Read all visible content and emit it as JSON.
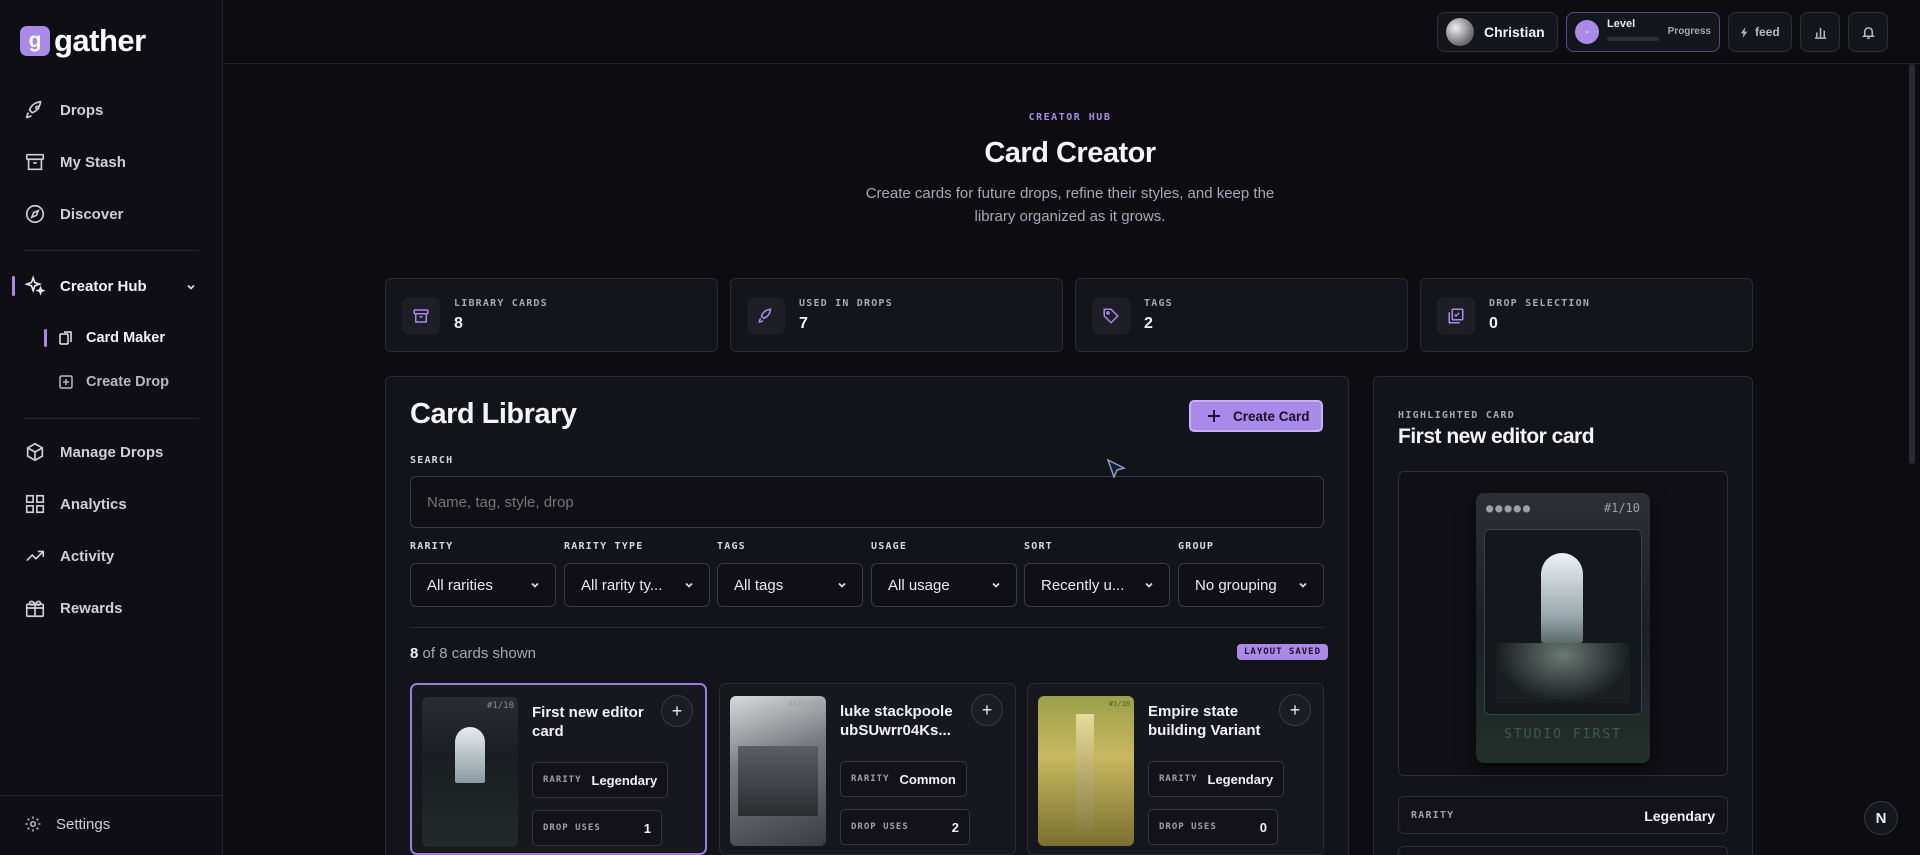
{
  "brand": {
    "logo_letter": "g",
    "name": "gather"
  },
  "sidebar": {
    "items": [
      {
        "label": "Drops"
      },
      {
        "label": "My Stash"
      },
      {
        "label": "Discover"
      },
      {
        "label": "Creator Hub"
      },
      {
        "label": "Card Maker"
      },
      {
        "label": "Create Drop"
      },
      {
        "label": "Manage Drops"
      },
      {
        "label": "Analytics"
      },
      {
        "label": "Activity"
      },
      {
        "label": "Rewards"
      }
    ],
    "settings": "Settings"
  },
  "topbar": {
    "user": "Christian",
    "level_badge": "-",
    "level_label": "Level",
    "progress_label": "Progress",
    "feed_label": "feed"
  },
  "hero": {
    "eyebrow": "CREATOR HUB",
    "title": "Card Creator",
    "subtitle_line1": "Create cards for future drops, refine their styles, and keep the",
    "subtitle_line2": "library organized as it grows."
  },
  "stats": [
    {
      "label": "LIBRARY CARDS",
      "value": "8"
    },
    {
      "label": "USED IN DROPS",
      "value": "7"
    },
    {
      "label": "TAGS",
      "value": "2"
    },
    {
      "label": "DROP SELECTION",
      "value": "0"
    }
  ],
  "library": {
    "title": "Card Library",
    "create_button": "Create Card",
    "search_label": "SEARCH",
    "search_placeholder": "Name, tag, style, drop",
    "filters": [
      {
        "label": "RARITY",
        "value": "All rarities"
      },
      {
        "label": "RARITY TYPE",
        "value": "All rarity ty..."
      },
      {
        "label": "TAGS",
        "value": "All tags"
      },
      {
        "label": "USAGE",
        "value": "All usage"
      },
      {
        "label": "SORT",
        "value": "Recently u..."
      },
      {
        "label": "GROUP",
        "value": "No grouping"
      }
    ],
    "count_shown": "8",
    "count_rest": "of 8 cards shown",
    "layout_badge": "LAYOUT SAVED",
    "cards": [
      {
        "title": "First new editor card",
        "rarity_key": "RARITY",
        "rarity": "Legendary",
        "uses_key": "DROP USES",
        "uses": "1",
        "serial": "#1/10"
      },
      {
        "title": "luke stackpoole ubSUwrr04Ks...",
        "rarity_key": "RARITY",
        "rarity": "Common",
        "uses_key": "DROP USES",
        "uses": "2",
        "serial": "#328/500"
      },
      {
        "title": "Empire state building Variant",
        "rarity_key": "RARITY",
        "rarity": "Legendary",
        "uses_key": "DROP USES",
        "uses": "0",
        "serial": "#1/10"
      }
    ]
  },
  "highlight": {
    "eyebrow": "HIGHLIGHTED CARD",
    "title": "First new editor card",
    "serial": "#1/10",
    "caption": "STUDIO FIRST",
    "rarity_key": "RARITY",
    "rarity": "Legendary"
  },
  "fab_letter": "N",
  "colors": {
    "accent": "#a98ae8",
    "background": "#0c0c11",
    "panel": "#13131a"
  }
}
